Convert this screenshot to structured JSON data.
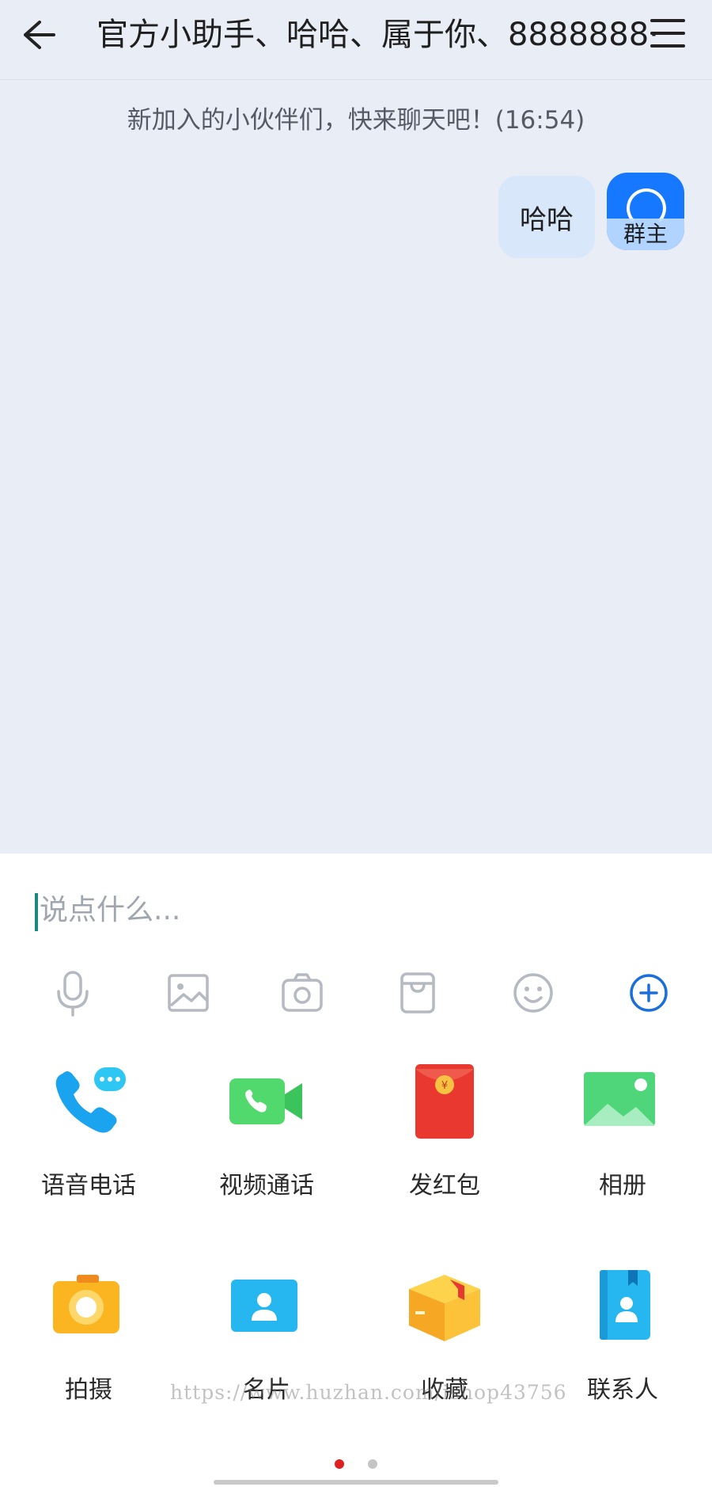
{
  "header": {
    "title": "官方小助手、哈哈、属于你、8888888·"
  },
  "chat": {
    "system_message": "新加入的小伙伴们，快来聊天吧！(16:54)",
    "messages": [
      {
        "text": "哈哈",
        "avatar_label": "群主"
      }
    ]
  },
  "input": {
    "placeholder": "说点什么..."
  },
  "toolbar": {
    "icons": [
      "microphone-icon",
      "image-icon",
      "camera-icon",
      "gift-box-icon",
      "emoji-icon",
      "add-icon"
    ],
    "accent_color": "#1a6fdb"
  },
  "actions": [
    {
      "label": "语音电话",
      "icon": "voice-call-icon"
    },
    {
      "label": "视频通话",
      "icon": "video-call-icon"
    },
    {
      "label": "发红包",
      "icon": "red-packet-icon"
    },
    {
      "label": "相册",
      "icon": "album-icon"
    },
    {
      "label": "拍摄",
      "icon": "capture-camera-icon"
    },
    {
      "label": "名片",
      "icon": "business-card-icon"
    },
    {
      "label": "收藏",
      "icon": "favorites-box-icon"
    },
    {
      "label": "联系人",
      "icon": "contacts-icon"
    }
  ],
  "watermark": "https://www.huzhan.com/ishop43756",
  "pager": {
    "pages": 2,
    "active": 1,
    "active_color": "#e02020",
    "inactive_color": "#c4c4c4"
  }
}
